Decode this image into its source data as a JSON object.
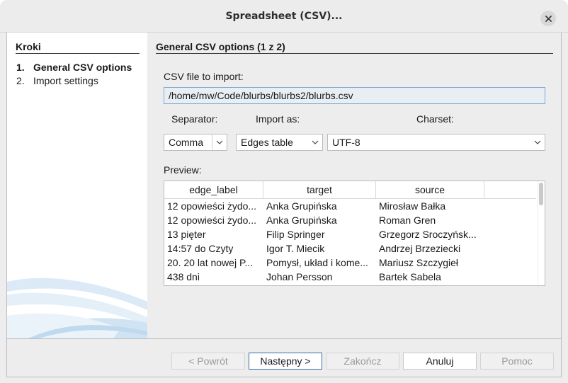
{
  "window": {
    "title": "Spreadsheet (CSV)..."
  },
  "sidebar": {
    "title": "Kroki",
    "steps": [
      {
        "num": "1.",
        "label": "General CSV options"
      },
      {
        "num": "2.",
        "label": "Import settings"
      }
    ]
  },
  "main": {
    "section_title": "General CSV options (1 z 2)",
    "file_label": "CSV file to import:",
    "file_path": "/home/mw/Code/blurbs/blurbs2/blurbs.csv",
    "separator_label": "Separator:",
    "import_as_label": "Import as:",
    "charset_label": "Charset:",
    "separator_value": "Comma",
    "import_as_value": "Edges table",
    "charset_value": "UTF-8",
    "preview_label": "Preview:",
    "preview": {
      "columns": [
        "edge_label",
        "target",
        "source"
      ],
      "rows": [
        [
          "12 opowieści żydo...",
          "Anka Grupińska",
          "Mirosław Bałka"
        ],
        [
          "12 opowieści żydo...",
          "Anka Grupińska",
          "Roman Gren"
        ],
        [
          "13 pięter",
          "Filip Springer",
          "Grzegorz Sroczyńsk..."
        ],
        [
          "14:57 do Czyty",
          "Igor T. Miecik",
          "Andrzej Brzeziecki"
        ],
        [
          "20. 20 lat nowej P...",
          "Pomysł, układ i kome...",
          "Mariusz Szczygieł"
        ],
        [
          "438 dni",
          "Johan Persson",
          "Bartek Sabela"
        ]
      ]
    }
  },
  "footer": {
    "back": "< Powrót",
    "next": "Następny >",
    "finish": "Zakończ",
    "cancel": "Anuluj",
    "help": "Pomoc"
  },
  "colors": {
    "accent_border": "#3a6ea5",
    "file_input_bg": "#e9eef3",
    "swoosh": "#cfe3f3"
  },
  "icons": {
    "close": "close-icon",
    "dropdown": "chevron-down-icon",
    "decoration": "swoosh-logo"
  }
}
